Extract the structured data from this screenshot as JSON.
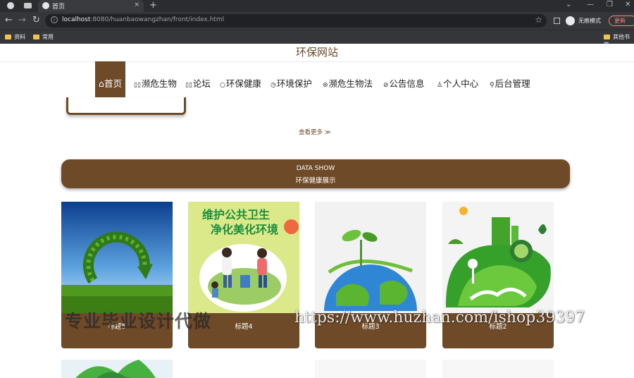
{
  "browser": {
    "tab_title": "首页",
    "tab_close": "×",
    "new_tab": "+",
    "url_host": "localhost",
    "url_rest": ":8080/huanbaowangzhan/front/index.html",
    "incognito_label": "无痕模式",
    "update_label": "更新",
    "bookmarks": [
      "资料",
      "常用",
      "其他书签"
    ]
  },
  "site": {
    "title": "环保网站",
    "nav": [
      {
        "icon": "⌂",
        "label": "首页"
      },
      {
        "icon": "▯▯",
        "label": "濒危生物"
      },
      {
        "icon": "▯▯",
        "label": "论坛"
      },
      {
        "icon": "○",
        "label": "环保健康"
      },
      {
        "icon": "◷",
        "label": "环境保护"
      },
      {
        "icon": "⊜",
        "label": "濒危生物法"
      },
      {
        "icon": "⊘",
        "label": "公告信息"
      },
      {
        "icon": "♙",
        "label": "个人中心"
      },
      {
        "icon": "⚲",
        "label": "后台管理"
      }
    ],
    "more_link": "查看更多 ≫",
    "banner": {
      "en": "DATA SHOW",
      "cn": "环保健康展示"
    },
    "cards": [
      {
        "caption": "标题5",
        "poster_line1": "",
        "poster_line2": ""
      },
      {
        "caption": "标题4",
        "poster_line1": "维护公共卫生",
        "poster_line2": "净化美化环境"
      },
      {
        "caption": "标题3"
      },
      {
        "caption": "标题2"
      }
    ]
  },
  "watermark": {
    "left": "专业毕业设计代做",
    "right": "https://www.huzhan.com/ishop39397"
  },
  "colors": {
    "brand": "#6e4a28",
    "chrome_dark": "#35363a"
  }
}
